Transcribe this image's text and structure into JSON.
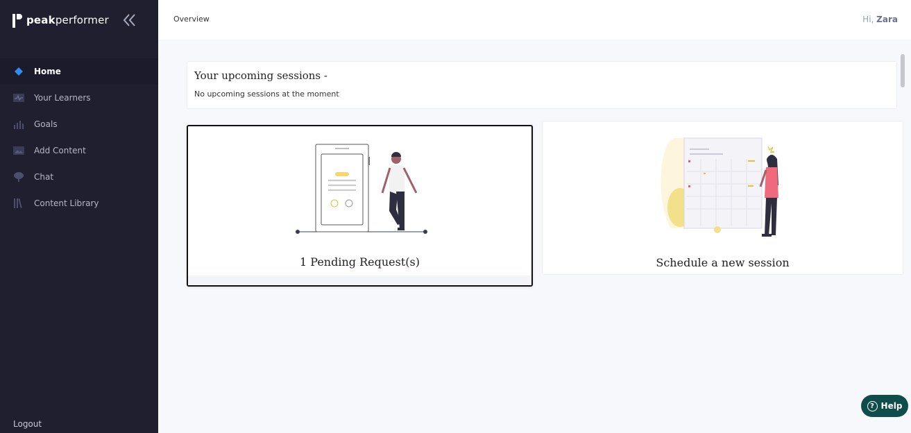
{
  "brand": {
    "name_bold": "peak",
    "name_light": "performer"
  },
  "nav": {
    "items": [
      {
        "label": "Home",
        "icon": "diamond-icon"
      },
      {
        "label": "Your Learners",
        "icon": "activity-icon"
      },
      {
        "label": "Goals",
        "icon": "bar-chart-icon"
      },
      {
        "label": "Add Content",
        "icon": "image-icon"
      },
      {
        "label": "Chat",
        "icon": "chat-icon"
      },
      {
        "label": "Content Library",
        "icon": "library-icon"
      }
    ],
    "active": "Home",
    "logout_label": "Logout"
  },
  "topbar": {
    "breadcrumb": "Overview",
    "greeting_prefix": "Hi,",
    "user_name": "Zara"
  },
  "upcoming": {
    "title": "Your upcoming sessions -",
    "subtitle": "No upcoming sessions at the moment"
  },
  "cards": {
    "pending_label": "1 Pending Request(s)",
    "schedule_label": "Schedule a new session"
  },
  "help": {
    "label": "Help",
    "icon": "question-circle-icon"
  },
  "colors": {
    "sidebar": "#1f1f30",
    "accent_blue": "#2f8cf0",
    "help_bg": "#0f4d4a"
  }
}
